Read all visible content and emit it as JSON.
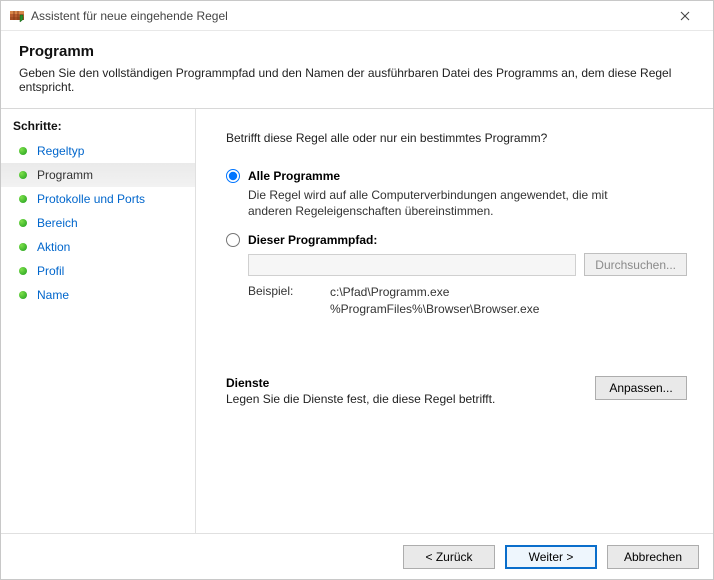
{
  "window": {
    "title": "Assistent für neue eingehende Regel"
  },
  "header": {
    "title": "Programm",
    "subtitle": "Geben Sie den vollständigen Programmpfad und den Namen der ausführbaren Datei des Programms an, dem diese Regel entspricht."
  },
  "sidebar": {
    "title": "Schritte:",
    "items": [
      {
        "label": "Regeltyp"
      },
      {
        "label": "Programm"
      },
      {
        "label": "Protokolle und Ports"
      },
      {
        "label": "Bereich"
      },
      {
        "label": "Aktion"
      },
      {
        "label": "Profil"
      },
      {
        "label": "Name"
      }
    ],
    "active_index": 1
  },
  "content": {
    "question": "Betrifft diese Regel alle oder nur ein bestimmtes Programm?",
    "option_all": {
      "label": "Alle Programme",
      "desc": "Die Regel wird auf alle Computerverbindungen angewendet, die mit anderen Regeleigenschaften übereinstimmen."
    },
    "option_path": {
      "label": "Dieser Programmpfad:",
      "input_value": "",
      "browse_label": "Durchsuchen...",
      "example_label": "Beispiel:",
      "example_line1": "c:\\Pfad\\Programm.exe",
      "example_line2": "%ProgramFiles%\\Browser\\Browser.exe"
    },
    "selected_option": "all",
    "services": {
      "title": "Dienste",
      "desc": "Legen Sie die Dienste fest, die diese Regel betrifft.",
      "button": "Anpassen..."
    }
  },
  "footer": {
    "back": "< Zurück",
    "next": "Weiter >",
    "cancel": "Abbrechen"
  }
}
